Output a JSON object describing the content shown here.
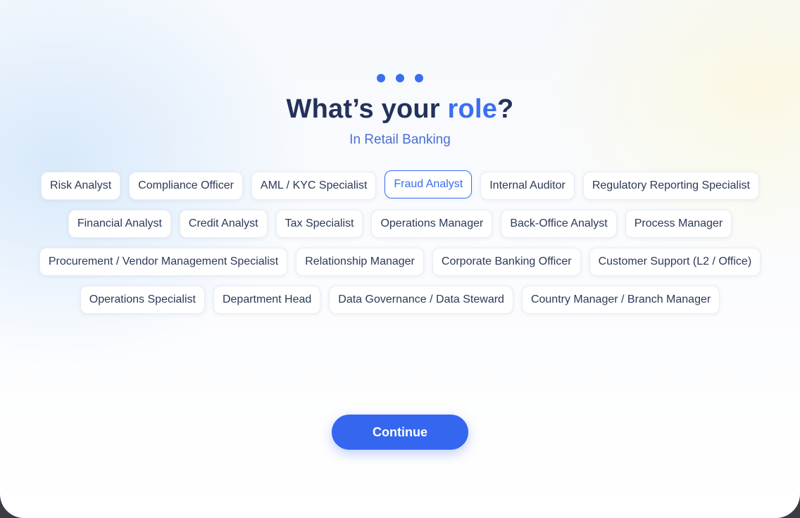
{
  "header": {
    "title_prefix": "What’s your ",
    "title_accent": "role",
    "title_suffix": "?",
    "subtitle": "In Retail Banking"
  },
  "roles": {
    "row1": [
      "Risk Analyst",
      "Compliance Officer",
      "AML / KYC Specialist",
      "Fraud Analyst",
      "Internal Auditor",
      "Regulatory Reporting Specialist"
    ],
    "row2": [
      "Financial Analyst",
      "Credit Analyst",
      "Tax Specialist",
      "Operations Manager",
      "Back-Office Analyst",
      "Process Manager"
    ],
    "row3": [
      "Procurement / Vendor Management Specialist",
      "Relationship Manager",
      "Corporate Banking Officer",
      "Customer Support (L2 / Office)"
    ],
    "row4": [
      "Operations Specialist",
      "Department Head",
      "Data Governance / Data Steward",
      "Country Manager / Branch Manager"
    ]
  },
  "selected_role": "Fraud Analyst",
  "actions": {
    "continue_label": "Continue"
  },
  "colors": {
    "accent": "#3b6df0",
    "title": "#23325a",
    "button": "#3566f0"
  }
}
